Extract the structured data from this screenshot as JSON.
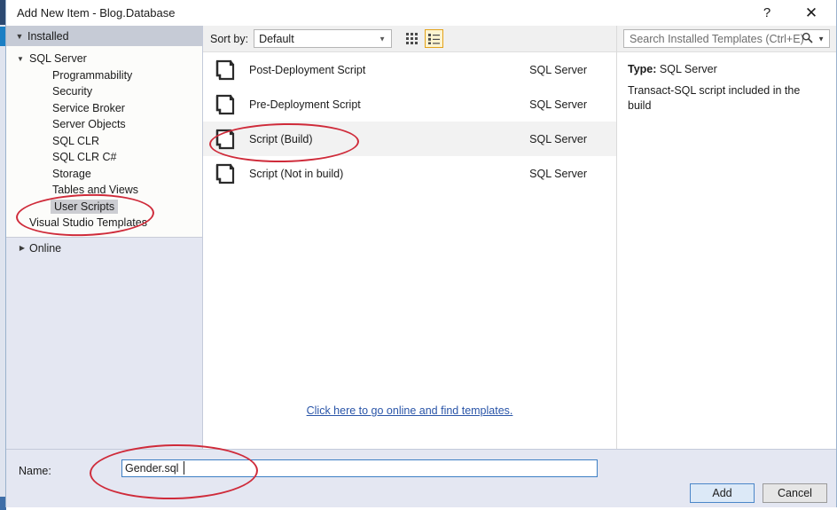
{
  "window": {
    "title": "Add New Item - Blog.Database",
    "help_label": "?",
    "close_label": "✕"
  },
  "sidebar": {
    "installed_header": "Installed",
    "online_header": "Online",
    "tree": [
      {
        "label": "SQL Server",
        "level": 0,
        "expanded": true,
        "selected": false
      },
      {
        "label": "Programmability",
        "level": 1,
        "selected": false
      },
      {
        "label": "Security",
        "level": 1,
        "selected": false
      },
      {
        "label": "Service Broker",
        "level": 1,
        "selected": false
      },
      {
        "label": "Server Objects",
        "level": 1,
        "selected": false
      },
      {
        "label": "SQL CLR",
        "level": 1,
        "selected": false
      },
      {
        "label": "SQL CLR C#",
        "level": 1,
        "selected": false
      },
      {
        "label": "Storage",
        "level": 1,
        "selected": false
      },
      {
        "label": "Tables and Views",
        "level": 1,
        "selected": false
      },
      {
        "label": "User Scripts",
        "level": 1,
        "selected": true
      },
      {
        "label": "Visual Studio Templates",
        "level": 0,
        "selected": false
      }
    ]
  },
  "toolbar": {
    "sort_by_label": "Sort by:",
    "sort_by_value": "Default",
    "grid_view_title": "Large Icons",
    "list_view_title": "List View"
  },
  "search": {
    "placeholder": "Search Installed Templates (Ctrl+E)"
  },
  "templates": {
    "items": [
      {
        "name": "Post-Deployment Script",
        "origin": "SQL Server",
        "selected": false
      },
      {
        "name": "Pre-Deployment Script",
        "origin": "SQL Server",
        "selected": false
      },
      {
        "name": "Script (Build)",
        "origin": "SQL Server",
        "selected": true
      },
      {
        "name": "Script (Not in build)",
        "origin": "SQL Server",
        "selected": false
      }
    ],
    "online_link": "Click here to go online and find templates."
  },
  "details": {
    "type_label": "Type:",
    "type_value": "SQL Server",
    "description": "Transact-SQL script included in the build"
  },
  "footer": {
    "name_label": "Name:",
    "name_value": "Gender.sql",
    "add_label": "Add",
    "cancel_label": "Cancel"
  },
  "colors": {
    "accent": "#3d7fc4",
    "annotation": "#cf2b3a",
    "selection": "#f2f2f2",
    "sidebar_bg": "#e4e7f2",
    "link": "#2a55a8"
  }
}
